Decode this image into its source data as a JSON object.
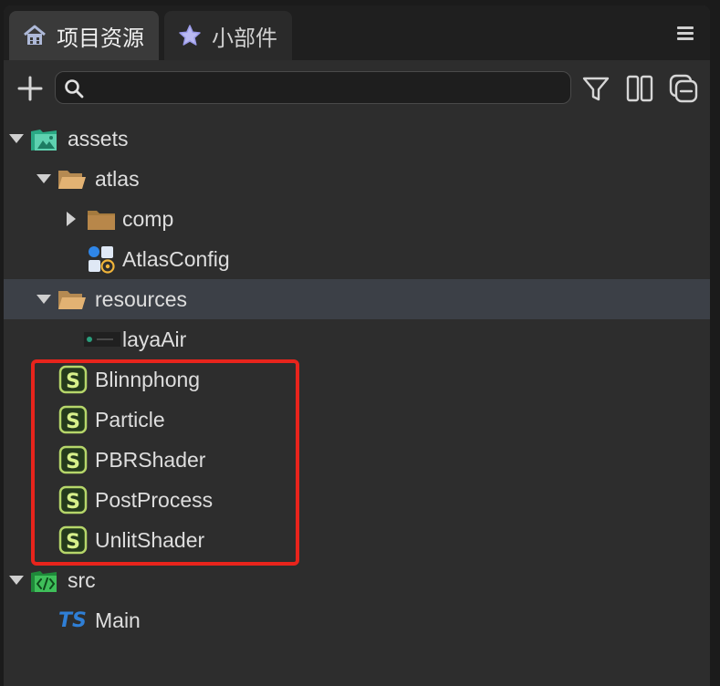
{
  "tabs": [
    {
      "label": "项目资源",
      "icon": "home-icon",
      "active": true
    },
    {
      "label": "小部件",
      "icon": "star-icon",
      "active": false
    }
  ],
  "toolbar": {
    "search_value": "",
    "search_placeholder": "",
    "icons": [
      "add-icon",
      "search-icon",
      "filter-icon",
      "split-view-icon",
      "collapse-all-icon"
    ]
  },
  "tree": {
    "assets": "assets",
    "atlas": "atlas",
    "comp": "comp",
    "atlas_config": "AtlasConfig",
    "resources": "resources",
    "laya_air": "layaAir",
    "shaders": [
      "Blinnphong",
      "Particle",
      "PBRShader",
      "PostProcess",
      "UnlitShader"
    ],
    "src": "src",
    "main": "Main",
    "ts_badge": "TS",
    "shader_badge": "S"
  },
  "colors": {
    "accent": "#e8241c",
    "selected_row": "#3c4047",
    "folder": "#d9a463",
    "shader_green": "#b6d66a",
    "ts_blue": "#2f7fd6"
  }
}
